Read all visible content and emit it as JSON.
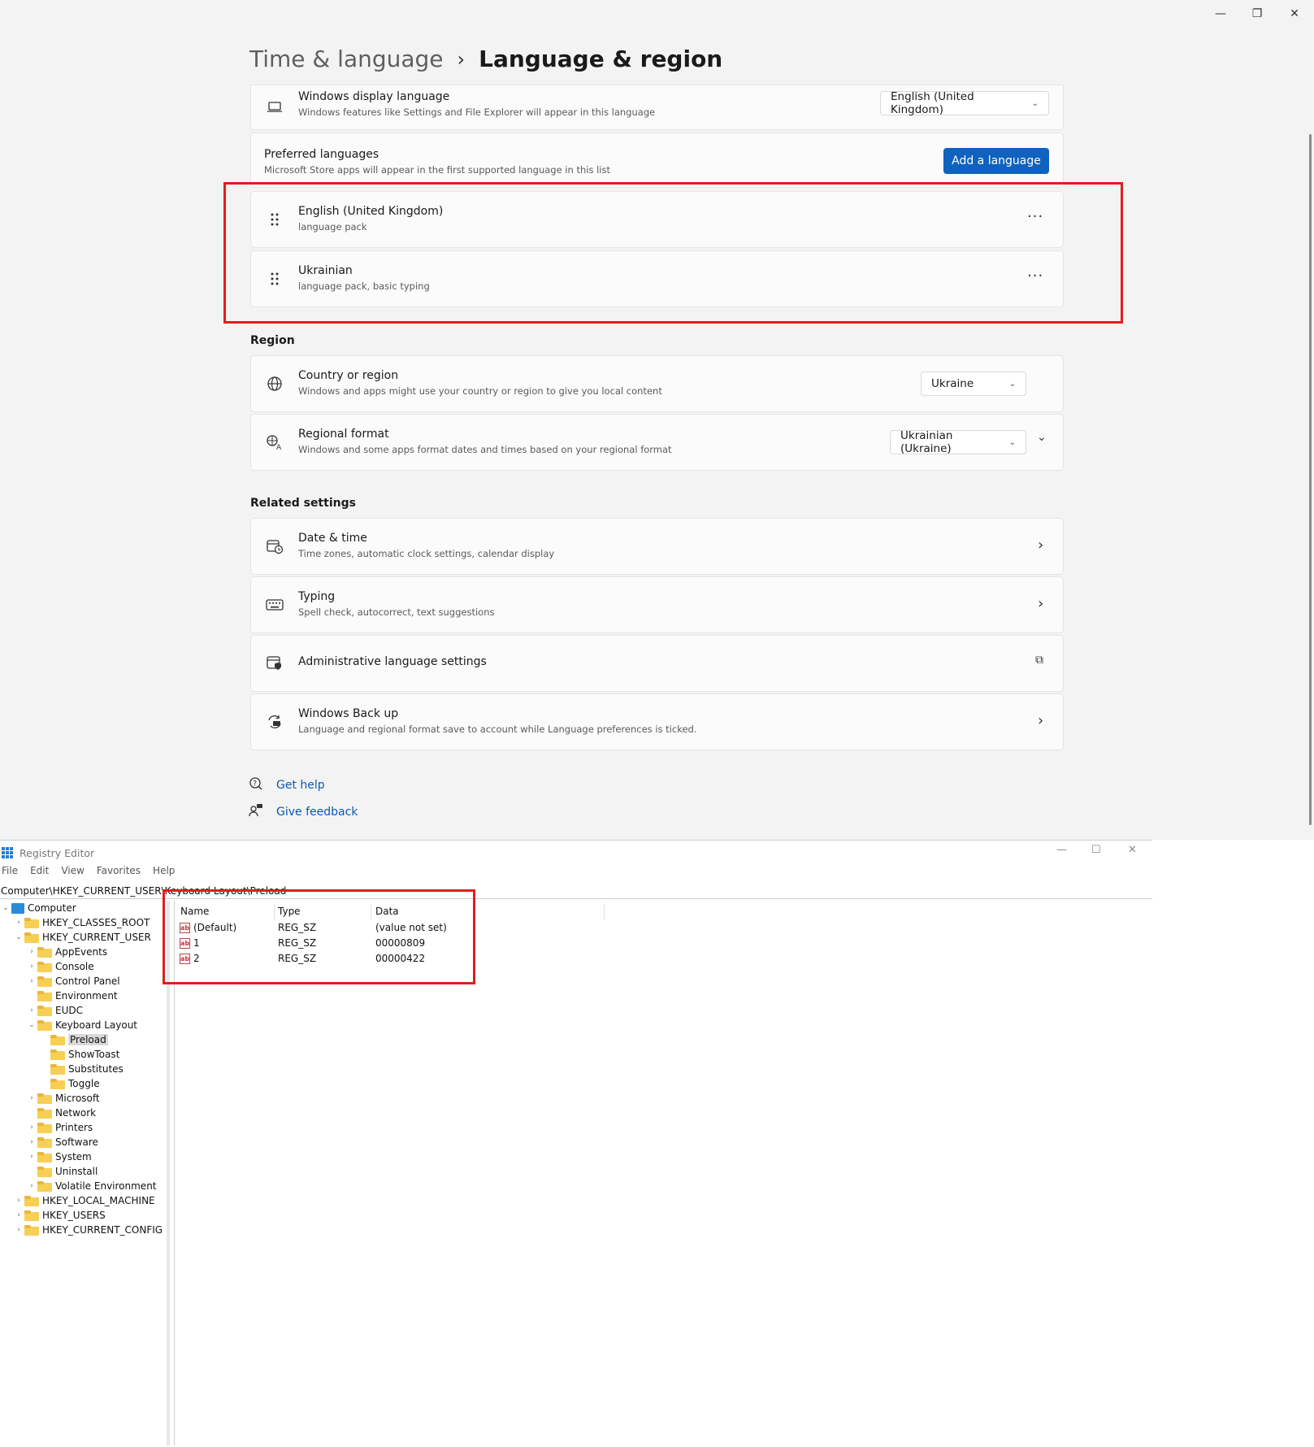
{
  "settings": {
    "breadcrumb": {
      "parent": "Time & language",
      "current": "Language & region"
    },
    "display_language": {
      "title": "Windows display language",
      "desc": "Windows features like Settings and File Explorer will appear in this language",
      "value": "English (United Kingdom)"
    },
    "preferred": {
      "title": "Preferred languages",
      "desc": "Microsoft Store apps will appear in the first supported language in this list",
      "button": "Add a language"
    },
    "languages": [
      {
        "title": "English (United Kingdom)",
        "desc": "language pack"
      },
      {
        "title": "Ukrainian",
        "desc": "language pack, basic typing"
      }
    ],
    "region_label": "Region",
    "country": {
      "title": "Country or region",
      "desc": "Windows and apps might use your country or region to give you local content",
      "value": "Ukraine"
    },
    "regional_format": {
      "title": "Regional format",
      "desc": "Windows and some apps format dates and times based on your regional format",
      "value": "Ukrainian (Ukraine)"
    },
    "related_label": "Related settings",
    "related": [
      {
        "title": "Date & time",
        "desc": "Time zones, automatic clock settings, calendar display"
      },
      {
        "title": "Typing",
        "desc": "Spell check, autocorrect, text suggestions"
      },
      {
        "title": "Administrative language settings",
        "desc": ""
      },
      {
        "title": "Windows Back up",
        "desc": "Language and regional format save to account while Language preferences is ticked."
      }
    ],
    "help": {
      "get_help": "Get help",
      "give_feedback": "Give feedback"
    }
  },
  "registry": {
    "title": "Registry Editor",
    "menu": [
      "File",
      "Edit",
      "View",
      "Favorites",
      "Help"
    ],
    "address": "Computer\\HKEY_CURRENT_USER\\Keyboard Layout\\Preload",
    "tree": {
      "computer": "Computer",
      "hkcr": "HKEY_CLASSES_ROOT",
      "hkcu": "HKEY_CURRENT_USER",
      "appevents": "AppEvents",
      "console": "Console",
      "control_panel": "Control Panel",
      "environment": "Environment",
      "eudc": "EUDC",
      "keyboard_layout": "Keyboard Layout",
      "preload": "Preload",
      "showtoast": "ShowToast",
      "substitutes": "Substitutes",
      "toggle": "Toggle",
      "microsoft": "Microsoft",
      "network": "Network",
      "printers": "Printers",
      "software": "Software",
      "system": "System",
      "uninstall": "Uninstall",
      "volatile": "Volatile Environment",
      "hklm": "HKEY_LOCAL_MACHINE",
      "hku": "HKEY_USERS",
      "hkcc": "HKEY_CURRENT_CONFIG"
    },
    "columns": {
      "name": "Name",
      "type": "Type",
      "data": "Data"
    },
    "values": [
      {
        "name": "(Default)",
        "type": "REG_SZ",
        "data": "(value not set)"
      },
      {
        "name": "1",
        "type": "REG_SZ",
        "data": "00000809"
      },
      {
        "name": "2",
        "type": "REG_SZ",
        "data": "00000422"
      }
    ]
  }
}
